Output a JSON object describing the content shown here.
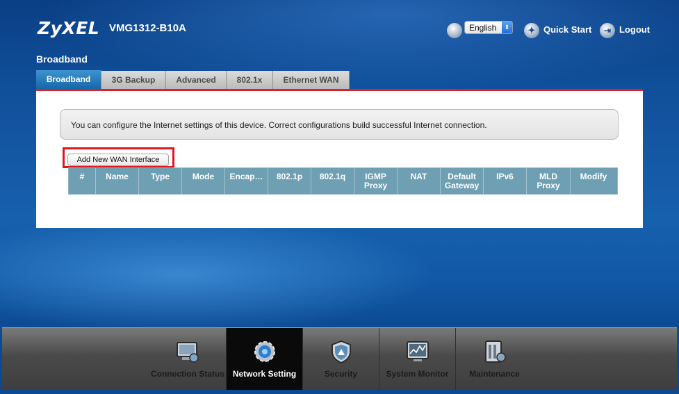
{
  "header": {
    "brand": "ZyXEL",
    "model": "VMG1312-B10A",
    "language": "English",
    "quick_start": "Quick Start",
    "logout": "Logout"
  },
  "page_title": "Broadband",
  "tabs": [
    {
      "label": "Broadband",
      "active": true
    },
    {
      "label": "3G Backup",
      "active": false
    },
    {
      "label": "Advanced",
      "active": false
    },
    {
      "label": "802.1x",
      "active": false
    },
    {
      "label": "Ethernet WAN",
      "active": false
    }
  ],
  "info_message": "You can configure the Internet settings of this device. Correct configurations build successful Internet connection.",
  "add_wan_button": "Add New WAN Interface",
  "table": {
    "columns": [
      "#",
      "Name",
      "Type",
      "Mode",
      "Encap…",
      "802.1p",
      "802.1q",
      "IGMP Proxy",
      "NAT",
      "Default Gateway",
      "IPv6",
      "MLD Proxy",
      "Modify"
    ],
    "rows": []
  },
  "bottom_nav": [
    {
      "label": "Connection Status",
      "icon": "connection-status-icon",
      "active": false
    },
    {
      "label": "Network Setting",
      "icon": "network-setting-icon",
      "active": true
    },
    {
      "label": "Security",
      "icon": "security-shield-icon",
      "active": false
    },
    {
      "label": "System Monitor",
      "icon": "system-monitor-icon",
      "active": false
    },
    {
      "label": "Maintenance",
      "icon": "maintenance-icon",
      "active": false
    }
  ],
  "colors": {
    "background": "#0d4f98",
    "active_tab": "#1e73b5",
    "accent_red": "#d72530",
    "table_header": "#6f9fb2",
    "highlight": "#e3161c"
  }
}
